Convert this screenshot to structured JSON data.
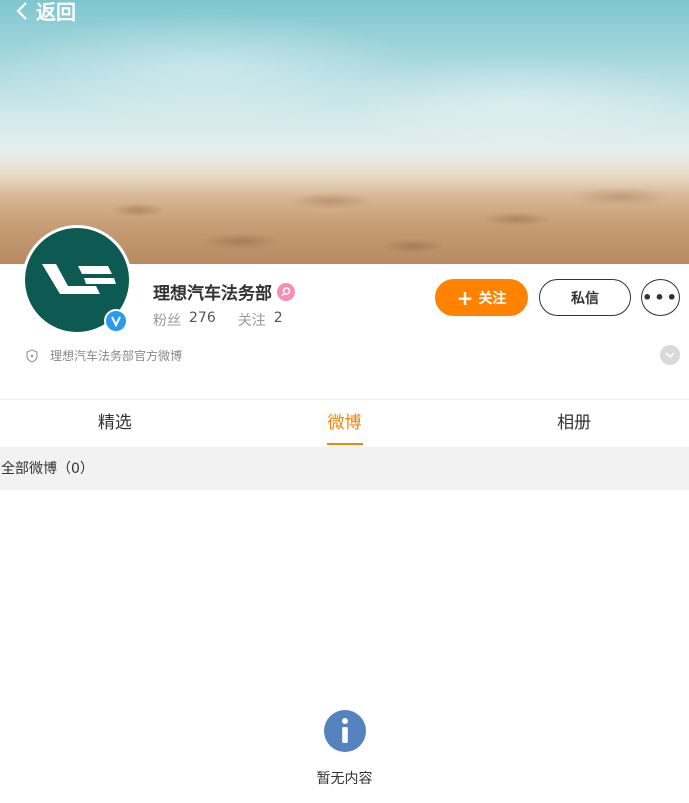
{
  "nav": {
    "back_label": "返回"
  },
  "profile": {
    "name": "理想汽车法务部",
    "fans_label": "粉丝",
    "fans_count": "276",
    "following_label": "关注",
    "following_count": "2",
    "description": "理想汽车法务部官方微博"
  },
  "actions": {
    "follow_plus": "+",
    "follow_label": "关注",
    "message_label": "私信",
    "more_label": "•••"
  },
  "tabs": [
    {
      "label": "精选",
      "active": false
    },
    {
      "label": "微博",
      "active": true
    },
    {
      "label": "相册",
      "active": false
    }
  ],
  "feed": {
    "section_title": "全部微博（0）",
    "empty_text": "暂无内容"
  },
  "colors": {
    "accent": "#ff8200",
    "avatar_bg": "#0d5a52",
    "verified": "#2a9cf0",
    "info_icon": "#5583c0"
  },
  "icons": {
    "back": "chevron-left-icon",
    "verified": "verified-v-icon",
    "vip": "vip-badge-icon",
    "shield": "shield-icon",
    "expand": "chevron-down-icon",
    "info": "info-icon"
  }
}
